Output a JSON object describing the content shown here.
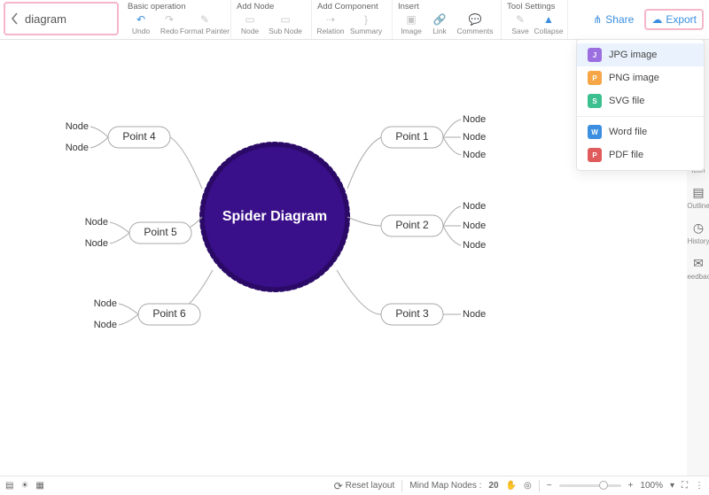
{
  "title": "diagram",
  "toolbar": {
    "groups": {
      "basic": {
        "title": "Basic operation",
        "undo": "Undo",
        "redo": "Redo",
        "format": "Format Painter"
      },
      "addnode": {
        "title": "Add Node",
        "node": "Node",
        "subnode": "Sub Node"
      },
      "addcomp": {
        "title": "Add Component",
        "relation": "Relation",
        "summary": "Summary"
      },
      "insert": {
        "title": "Insert",
        "image": "Image",
        "link": "Link",
        "comments": "Comments"
      },
      "settings": {
        "title": "Tool Settings",
        "save": "Save",
        "collapse": "Collapse"
      }
    },
    "share": "Share",
    "export": "Export"
  },
  "export_menu": {
    "jpg": "JPG image",
    "png": "PNG image",
    "svg": "SVG file",
    "word": "Word file",
    "pdf": "PDF file",
    "colors": {
      "jpg": "#9b6fe0",
      "png": "#f6a646",
      "svg": "#3cc08f",
      "word": "#3b8ee0",
      "pdf": "#e05b5b"
    },
    "selected": "jpg"
  },
  "side": {
    "icon": "Icon",
    "outline": "Outline",
    "history": "History",
    "feedback": "Feedback"
  },
  "diagram": {
    "center": "Spider Diagram",
    "center_fill": "#3a0f8a",
    "points": {
      "p1": "Point 1",
      "p2": "Point 2",
      "p3": "Point 3",
      "p4": "Point 4",
      "p5": "Point 5",
      "p6": "Point 6"
    },
    "node": "Node"
  },
  "statusbar": {
    "reset": "Reset layout",
    "nodes_label": "Mind Map Nodes :",
    "nodes_count": "20",
    "zoom": "100%"
  }
}
